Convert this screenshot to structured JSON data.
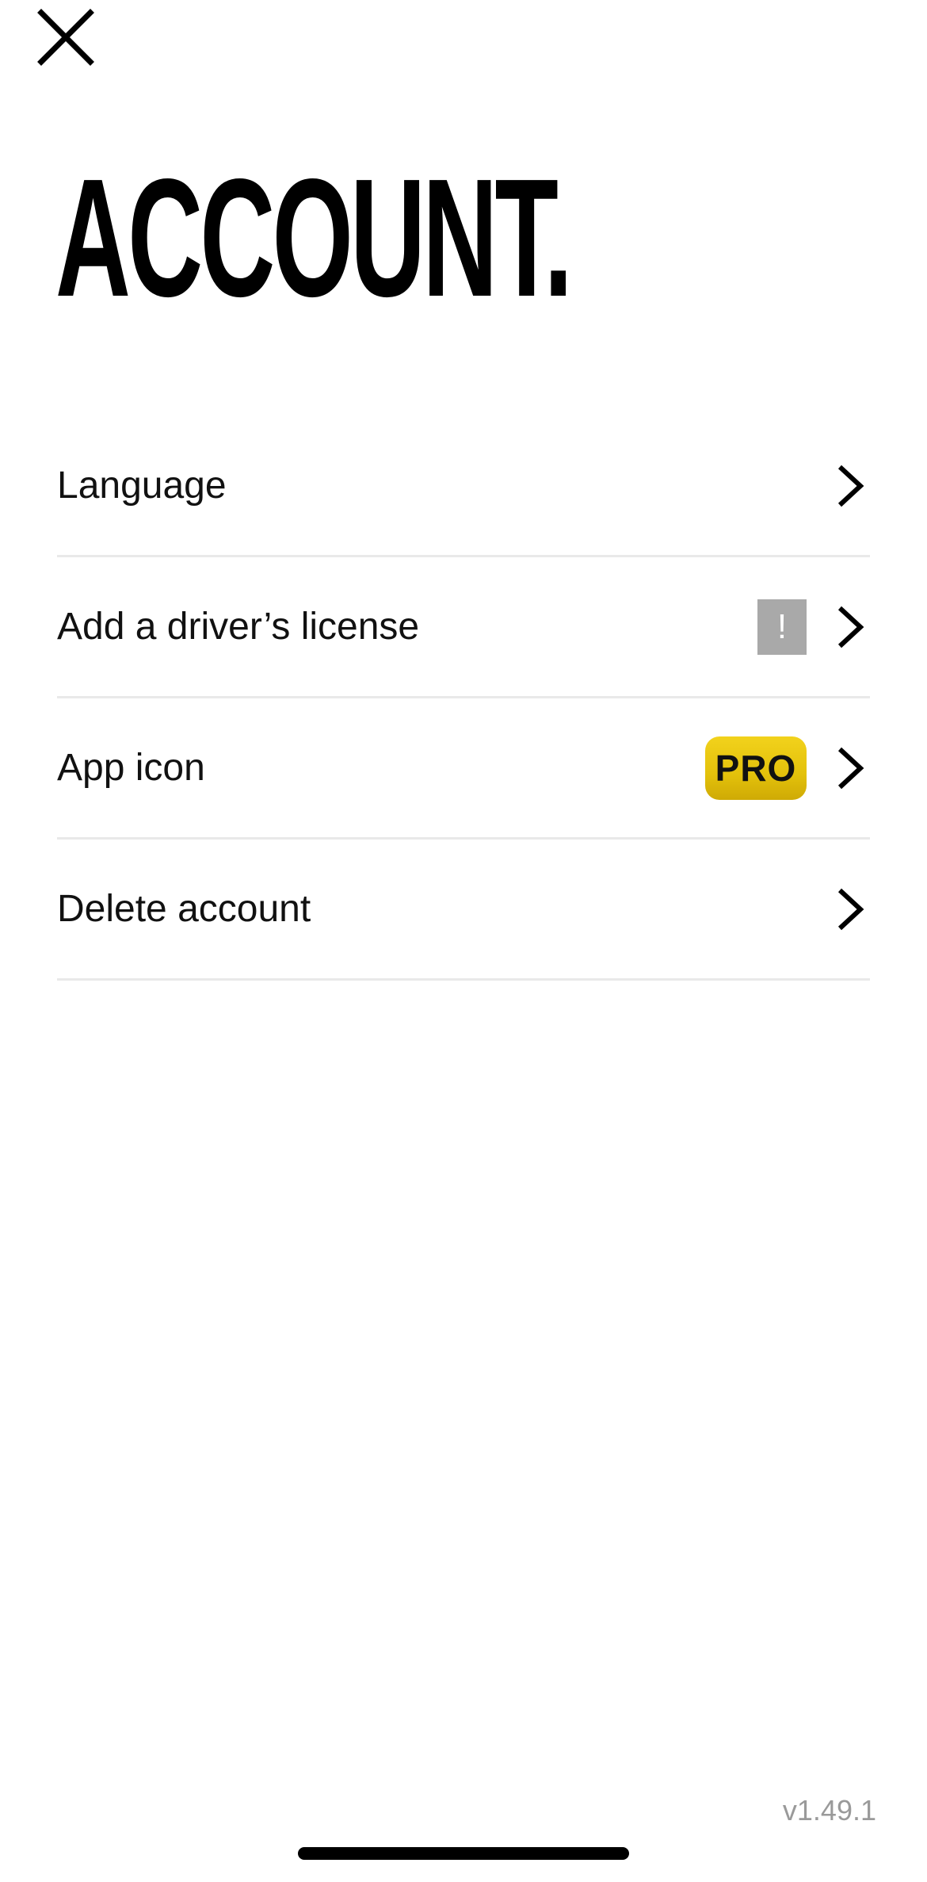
{
  "header": {
    "close_icon": "close-icon",
    "title": "ACCOUNT."
  },
  "menu": {
    "items": [
      {
        "label": "Language",
        "icon": "chevron-right-icon"
      },
      {
        "label": "Add a driver’s license",
        "badge": "!",
        "icon": "chevron-right-icon"
      },
      {
        "label": "App icon",
        "badge": "PRO",
        "icon": "chevron-right-icon"
      },
      {
        "label": "Delete account",
        "icon": "chevron-right-icon"
      }
    ]
  },
  "footer": {
    "version": "v1.49.1"
  },
  "colors": {
    "background": "#ffffff",
    "text": "#111111",
    "divider": "#e9e9e9",
    "alert_badge": "#a9a9a9",
    "pro_badge": "#e3c10b",
    "version_text": "#9a9a9a"
  }
}
